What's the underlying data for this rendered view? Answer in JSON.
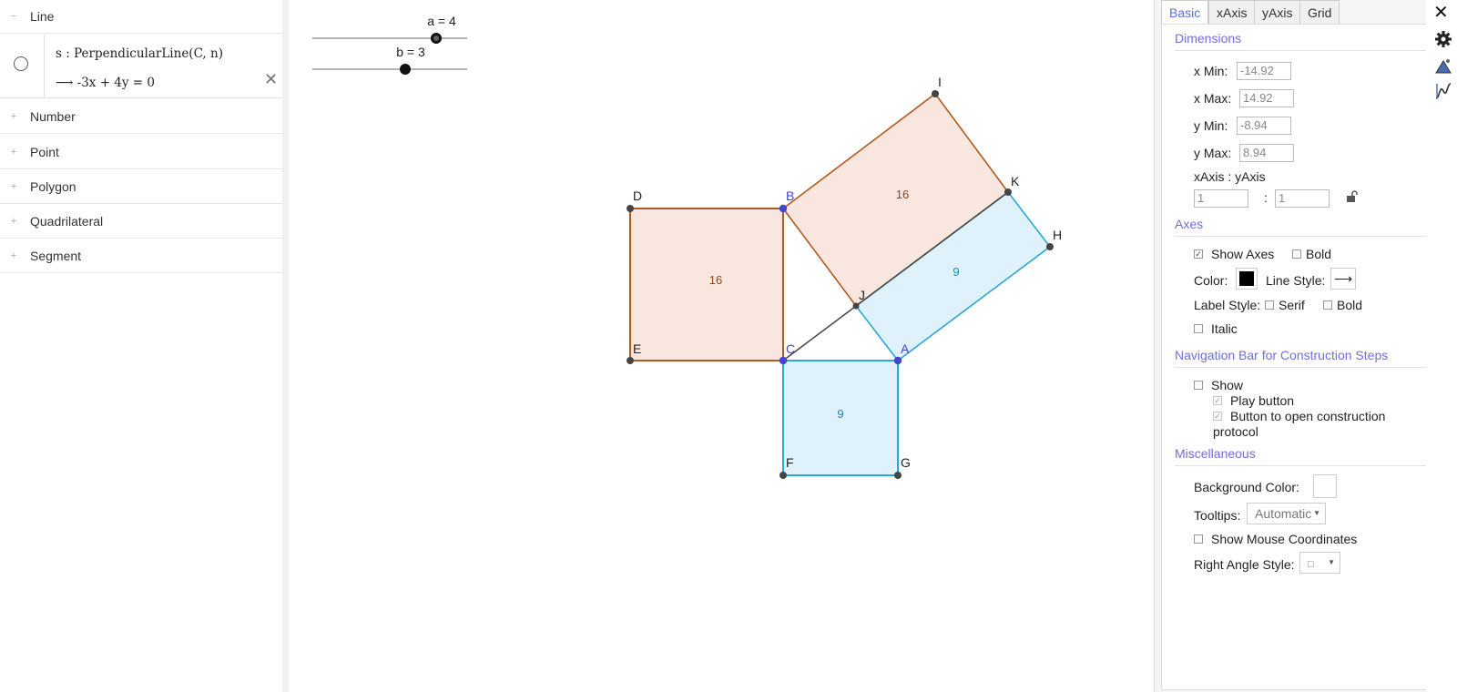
{
  "algebra": {
    "categories": [
      {
        "label": "Line",
        "toggle": "−"
      },
      {
        "label": "Number",
        "toggle": "+"
      },
      {
        "label": "Point",
        "toggle": "+"
      },
      {
        "label": "Polygon",
        "toggle": "+"
      },
      {
        "label": "Quadrilateral",
        "toggle": "+"
      },
      {
        "label": "Segment",
        "toggle": "+"
      }
    ],
    "item": {
      "definition": "s : PerpendicularLine(C, n)",
      "value": "⟶  -3x + 4y = 0",
      "close": "✕"
    }
  },
  "graphics": {
    "sliders": [
      {
        "label": "a = 4",
        "value": 4
      },
      {
        "label": "b = 3",
        "value": 3
      }
    ],
    "points": {
      "D": "D",
      "B": "B",
      "E": "E",
      "C": "C",
      "A": "A",
      "F": "F",
      "G": "G",
      "I": "I",
      "K": "K",
      "H": "H",
      "J": "J"
    },
    "areas": {
      "BCDE": "16",
      "BIKJ": "16",
      "JKHA": "9",
      "CAGF": "9"
    },
    "colors": {
      "orange": "#b05a1e",
      "orange_fill": "#f9e6de",
      "blue": "#29a9d4",
      "blue_fill": "#dff1fa",
      "free_point": "#4444cc"
    }
  },
  "settings": {
    "tabs": [
      "Basic",
      "xAxis",
      "yAxis",
      "Grid"
    ],
    "dimensions": {
      "title": "Dimensions",
      "xmin_label": "x Min:",
      "xmin": "-14.92",
      "xmax_label": "x Max:",
      "xmax": "14.92",
      "ymin_label": "y Min:",
      "ymin": "-8.94",
      "ymax_label": "y Max:",
      "ymax": "8.94",
      "ratio_label": "xAxis : yAxis",
      "ratio_x": "1",
      "ratio_sep": ":",
      "ratio_y": "1"
    },
    "axes": {
      "title": "Axes",
      "show_axes": "Show Axes",
      "bold": "Bold",
      "color_label": "Color:",
      "line_style_label": "Line Style:",
      "line_style_value": "⟶",
      "label_style_label": "Label Style:",
      "serif": "Serif",
      "label_bold": "Bold",
      "italic": "Italic",
      "axis_color": "#000000"
    },
    "navbar": {
      "title": "Navigation Bar for Construction Steps",
      "show": "Show",
      "play": "Play button",
      "open_protocol_line1": "Button to open construction",
      "open_protocol_line2": "protocol"
    },
    "misc": {
      "title": "Miscellaneous",
      "bg_color_label": "Background Color:",
      "tooltips_label": "Tooltips:",
      "tooltips_value": "Automatic",
      "mouse_coords": "Show Mouse Coordinates",
      "right_angle_label": "Right Angle Style:",
      "right_angle_value": "□"
    },
    "close": "✕"
  }
}
